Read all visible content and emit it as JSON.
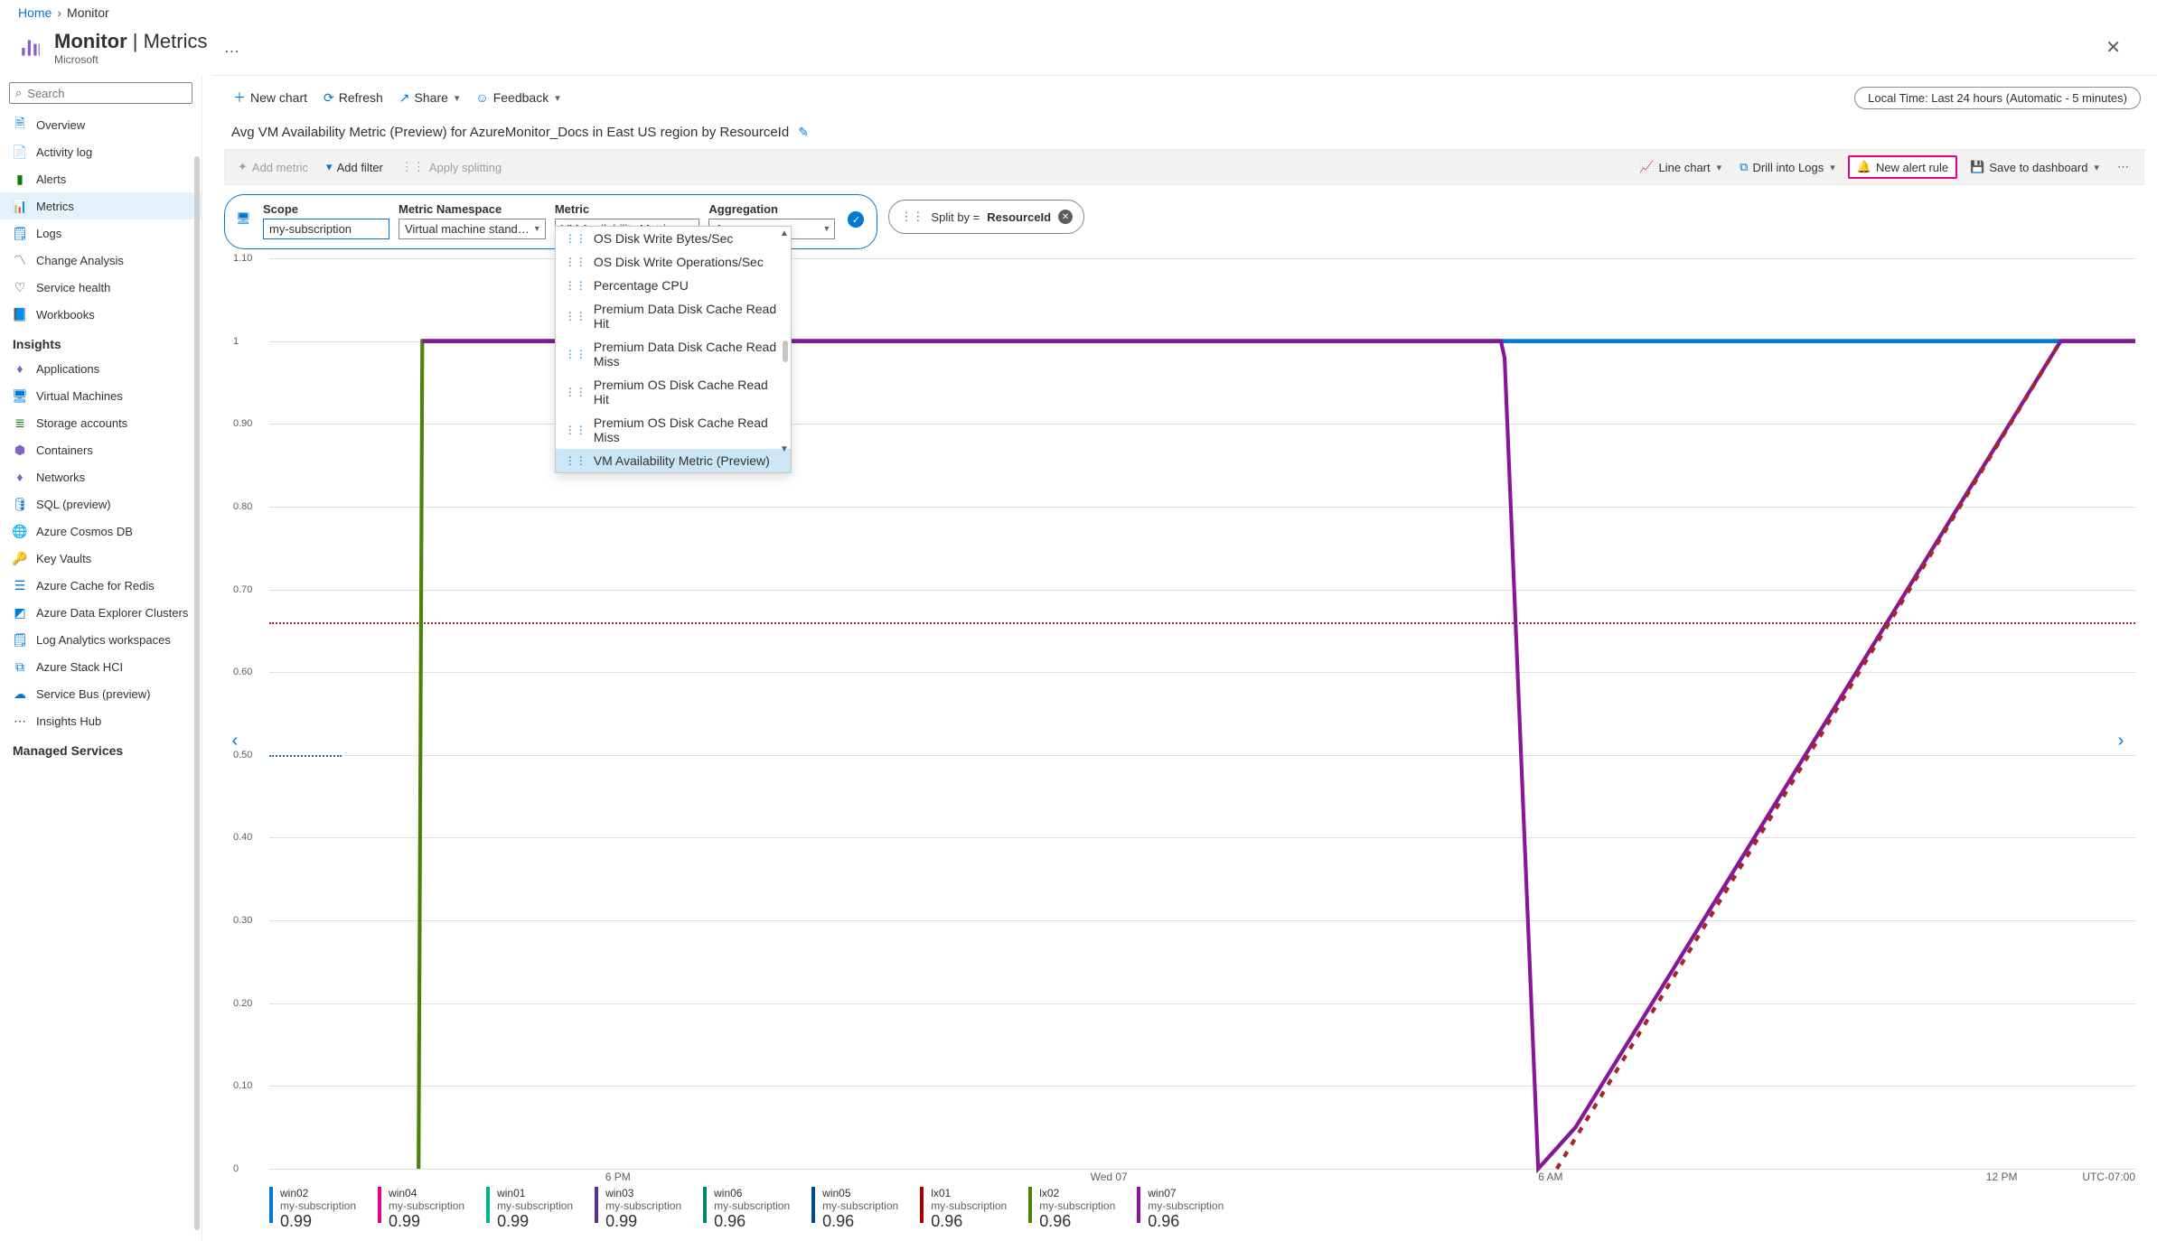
{
  "breadcrumb": {
    "home": "Home",
    "current": "Monitor"
  },
  "header": {
    "title_a": "Monitor",
    "title_b": "Metrics",
    "sub": "Microsoft"
  },
  "search": {
    "placeholder": "Search"
  },
  "nav": {
    "items": [
      {
        "label": "Overview"
      },
      {
        "label": "Activity log"
      },
      {
        "label": "Alerts"
      },
      {
        "label": "Metrics",
        "selected": true
      },
      {
        "label": "Logs"
      },
      {
        "label": "Change Analysis"
      },
      {
        "label": "Service health"
      },
      {
        "label": "Workbooks"
      }
    ],
    "section_insights": "Insights",
    "insights": [
      {
        "label": "Applications"
      },
      {
        "label": "Virtual Machines"
      },
      {
        "label": "Storage accounts"
      },
      {
        "label": "Containers"
      },
      {
        "label": "Networks"
      },
      {
        "label": "SQL (preview)"
      },
      {
        "label": "Azure Cosmos DB"
      },
      {
        "label": "Key Vaults"
      },
      {
        "label": "Azure Cache for Redis"
      },
      {
        "label": "Azure Data Explorer Clusters"
      },
      {
        "label": "Log Analytics workspaces"
      },
      {
        "label": "Azure Stack HCI"
      },
      {
        "label": "Service Bus (preview)"
      },
      {
        "label": "Insights Hub"
      }
    ],
    "section_managed": "Managed Services"
  },
  "toolbar": {
    "new_chart": "New chart",
    "refresh": "Refresh",
    "share": "Share",
    "feedback": "Feedback",
    "time_range": "Local Time: Last 24 hours (Automatic - 5 minutes)"
  },
  "chart_title": "Avg VM Availability Metric (Preview) for AzureMonitor_Docs in East US region by ResourceId",
  "cmdbar": {
    "add_metric": "Add metric",
    "add_filter": "Add filter",
    "apply_splitting": "Apply splitting",
    "line_chart": "Line chart",
    "drill_logs": "Drill into Logs",
    "new_alert": "New alert rule",
    "save_dash": "Save to dashboard"
  },
  "config": {
    "scope_label": "Scope",
    "scope_value": "my-subscription",
    "ns_label": "Metric Namespace",
    "ns_value": "Virtual machine stand…",
    "metric_label": "Metric",
    "metric_value": "VM Availability Metric…",
    "agg_label": "Aggregation",
    "agg_value": "Avg",
    "split_prefix": "Split by =",
    "split_value": "ResourceId"
  },
  "metric_options": [
    {
      "label": "OS Disk Write Bytes/Sec"
    },
    {
      "label": "OS Disk Write Operations/Sec"
    },
    {
      "label": "Percentage CPU"
    },
    {
      "label": "Premium Data Disk Cache Read Hit"
    },
    {
      "label": "Premium Data Disk Cache Read Miss"
    },
    {
      "label": "Premium OS Disk Cache Read Hit"
    },
    {
      "label": "Premium OS Disk Cache Read Miss"
    },
    {
      "label": "VM Availability Metric (Preview)",
      "selected": true
    }
  ],
  "chart_data": {
    "type": "line",
    "ylim": [
      0,
      1.1
    ],
    "yticks": [
      "1.10",
      "1",
      "0.90",
      "0.80",
      "0.70",
      "0.60",
      "0.50",
      "0.40",
      "0.30",
      "0.20",
      "0.10",
      "0"
    ],
    "xticks": [
      "6 PM",
      "Wed 07",
      "6 AM",
      "12 PM"
    ],
    "tz": "UTC-07:00",
    "threshold": 0.66,
    "note": "Most series flat at 1.0; one series drops from ~1.0 to 0 near 6 AM and rises back to 1.0 by ~12:30 PM",
    "series_info": [
      {
        "name": "win02",
        "sub": "my-subscription",
        "value": "0.99",
        "color": "#0078d4"
      },
      {
        "name": "win04",
        "sub": "my-subscription",
        "value": "0.99",
        "color": "#e3008c"
      },
      {
        "name": "win01",
        "sub": "my-subscription",
        "value": "0.99",
        "color": "#00b294"
      },
      {
        "name": "win03",
        "sub": "my-subscription",
        "value": "0.99",
        "color": "#5c2e91"
      },
      {
        "name": "win06",
        "sub": "my-subscription",
        "value": "0.96",
        "color": "#008272"
      },
      {
        "name": "win05",
        "sub": "my-subscription",
        "value": "0.96",
        "color": "#004b8d"
      },
      {
        "name": "lx01",
        "sub": "my-subscription",
        "value": "0.96",
        "color": "#a80000"
      },
      {
        "name": "lx02",
        "sub": "my-subscription",
        "value": "0.96",
        "color": "#498205"
      },
      {
        "name": "win07",
        "sub": "my-subscription",
        "value": "0.96",
        "color": "#881798"
      }
    ]
  }
}
